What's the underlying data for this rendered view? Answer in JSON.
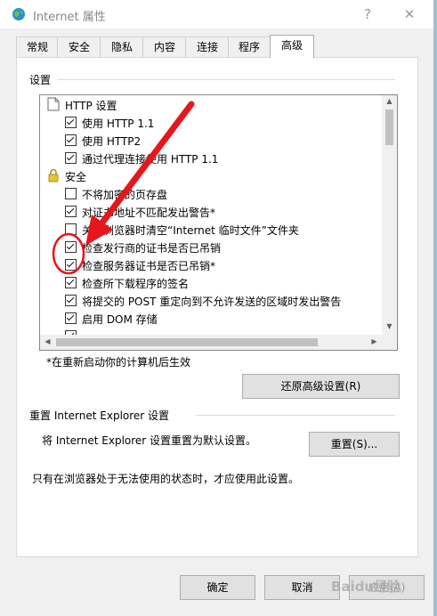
{
  "window": {
    "title": "Internet 属性",
    "help": "?",
    "close": "✕"
  },
  "tabs": [
    {
      "label": "常规"
    },
    {
      "label": "安全"
    },
    {
      "label": "隐私"
    },
    {
      "label": "内容"
    },
    {
      "label": "连接"
    },
    {
      "label": "程序"
    },
    {
      "label": "高级",
      "active": true
    }
  ],
  "settings": {
    "group_label": "设置",
    "items": [
      {
        "type": "category",
        "icon": "page-icon",
        "label": "HTTP 设置"
      },
      {
        "type": "checkbox",
        "checked": true,
        "label": "使用 HTTP 1.1"
      },
      {
        "type": "checkbox",
        "checked": true,
        "label": "使用 HTTP2"
      },
      {
        "type": "checkbox",
        "checked": true,
        "label": "通过代理连接使用 HTTP 1.1"
      },
      {
        "type": "category",
        "icon": "lock-icon",
        "label": "安全"
      },
      {
        "type": "checkbox",
        "checked": false,
        "label": "不将加密的页存盘"
      },
      {
        "type": "checkbox",
        "checked": true,
        "label": "对证书地址不匹配发出警告*"
      },
      {
        "type": "checkbox",
        "checked": false,
        "label": "关闭浏览器时清空“Internet 临时文件”文件夹"
      },
      {
        "type": "checkbox",
        "checked": true,
        "label": "检查发行商的证书是否已吊销"
      },
      {
        "type": "checkbox",
        "checked": true,
        "label": "检查服务器证书是否已吊销*"
      },
      {
        "type": "checkbox",
        "checked": true,
        "label": "检查所下载程序的签名"
      },
      {
        "type": "checkbox",
        "checked": true,
        "label": "将提交的 POST 重定向到不允许发送的区域时发出警告"
      },
      {
        "type": "checkbox",
        "checked": true,
        "label": "启用 DOM 存储"
      }
    ],
    "note": "*在重新启动你的计算机后生效",
    "restore_button": "还原高级设置(R)"
  },
  "reset": {
    "group_label": "重置 Internet Explorer 设置",
    "description": "将 Internet Explorer 设置重置为默认设置。",
    "reset_button": "重置(S)...",
    "hint": "只有在浏览器处于无法使用的状态时，才应使用此设置。"
  },
  "footer": {
    "ok": "确定",
    "cancel": "取消",
    "apply": "应用(A)"
  },
  "watermark": "Baidu经验",
  "colors": {
    "annotation": "#e8151b"
  }
}
